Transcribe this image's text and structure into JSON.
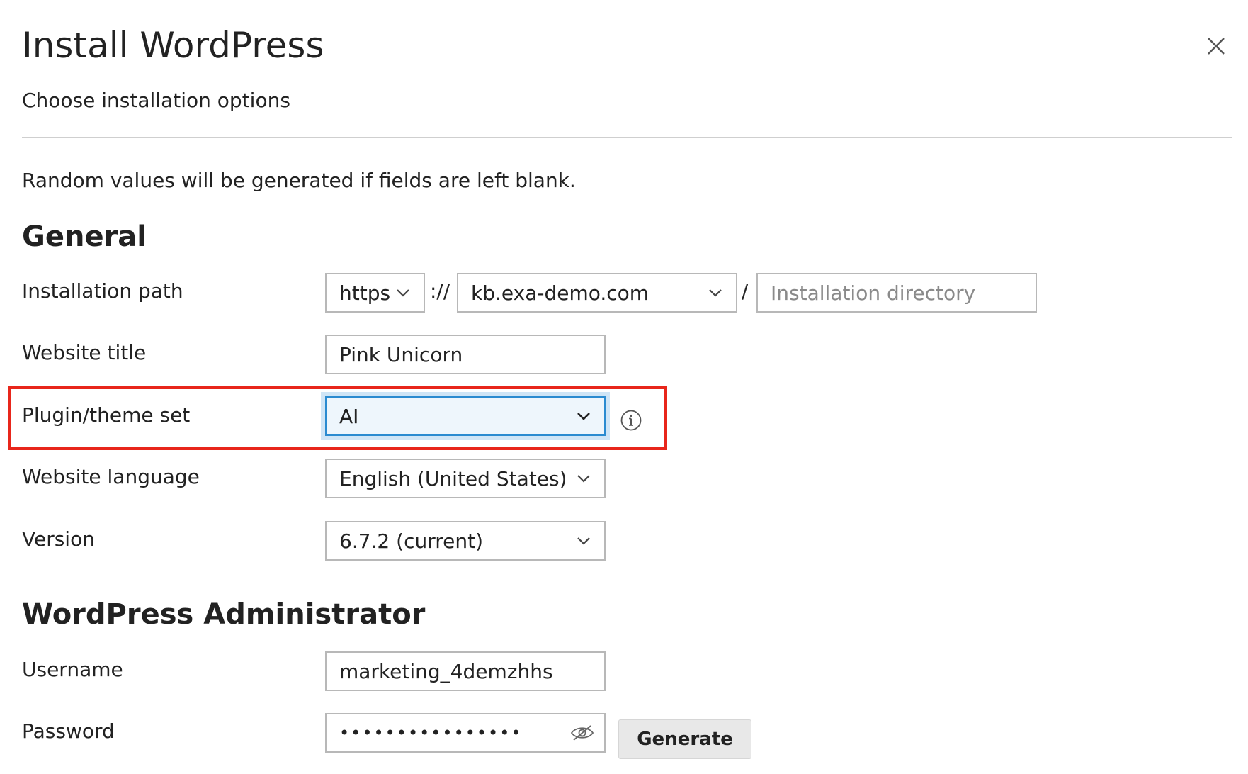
{
  "dialog": {
    "title": "Install WordPress",
    "subtitle": "Choose installation options",
    "hint": "Random values will be generated if fields are left blank."
  },
  "general": {
    "heading": "General",
    "installation_path": {
      "label": "Installation path",
      "protocol": "https",
      "separator": "://",
      "domain": "kb.exa-demo.com",
      "slash": "/",
      "directory_placeholder": "Installation directory",
      "directory_value": ""
    },
    "website_title": {
      "label": "Website title",
      "value": "Pink Unicorn"
    },
    "plugin_theme_set": {
      "label": "Plugin/theme set",
      "value": "AI",
      "info_icon": "info-icon"
    },
    "website_language": {
      "label": "Website language",
      "value": "English (United States)"
    },
    "version": {
      "label": "Version",
      "value": "6.7.2 (current)"
    }
  },
  "administrator": {
    "heading": "WordPress Administrator",
    "username": {
      "label": "Username",
      "value": "marketing_4demzhhs"
    },
    "password": {
      "label": "Password",
      "value": "••••••••••••••••",
      "visibility_icon": "eye-off-icon",
      "generate_label": "Generate"
    }
  },
  "icons": {
    "close": "close-icon",
    "dropdown": "chevron-down-icon"
  },
  "colors": {
    "highlight": "#e8261b",
    "focus": "#2b8bd0",
    "border": "#b8b8b8",
    "text": "#222222"
  }
}
